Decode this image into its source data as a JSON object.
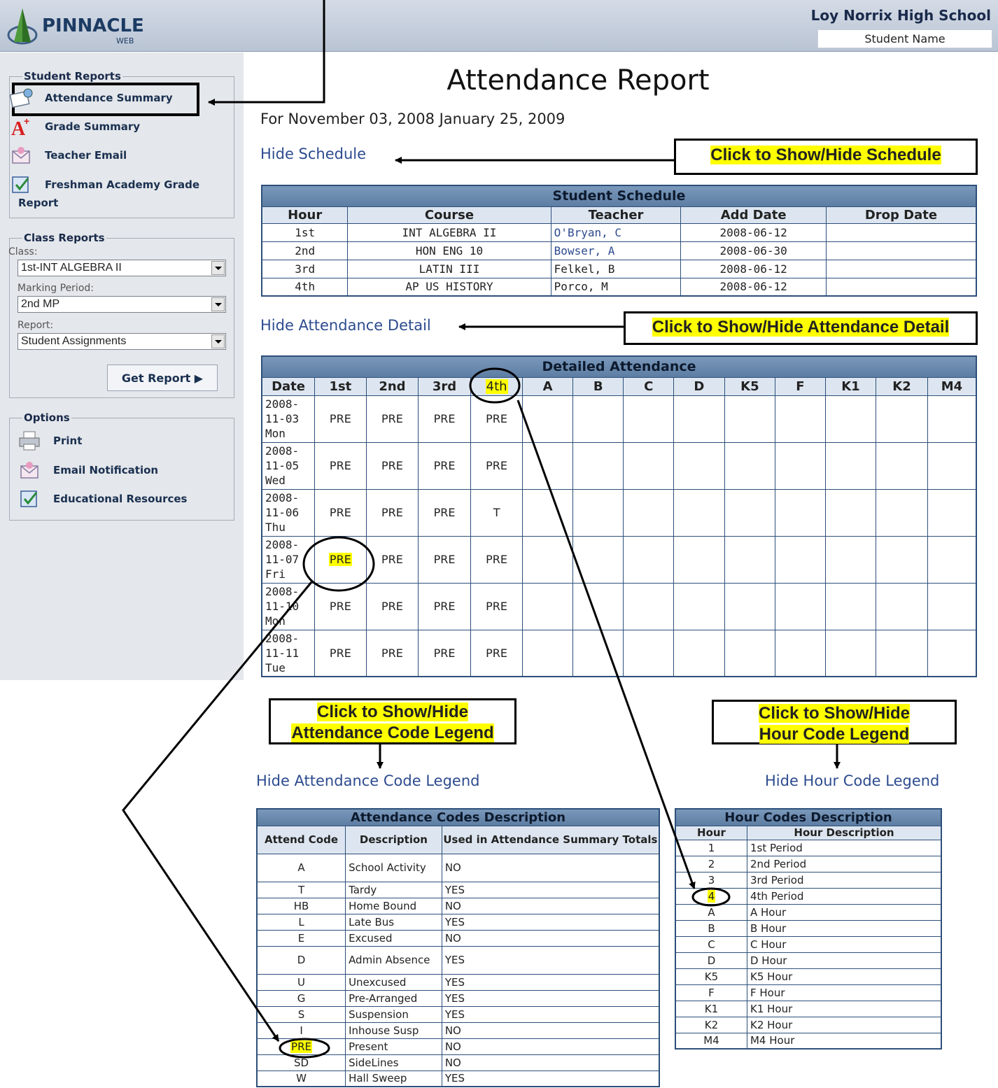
{
  "header": {
    "brand": "PINNACLE",
    "brand_sub": "WEB",
    "school": "Loy Norrix High School",
    "student": "Student Name"
  },
  "sidebar": {
    "student_reports": {
      "legend": "Student Reports",
      "items": [
        {
          "label": "Attendance Summary",
          "icon": "calendar-icon"
        },
        {
          "label": "Grade Summary",
          "icon": "grade-a-plus-icon"
        },
        {
          "label": "Teacher Email",
          "icon": "envelope-icon"
        },
        {
          "label": "Freshman Academy Grade",
          "label2": "Report",
          "icon": "checklist-icon"
        }
      ]
    },
    "class_reports": {
      "legend": "Class Reports",
      "class_label": "Class:",
      "class_value": "1st-INT ALGEBRA II",
      "mp_label": "Marking Period:",
      "mp_value": "2nd MP",
      "report_label": "Report:",
      "report_value": "Student Assignments",
      "button": "Get Report ▶"
    },
    "options": {
      "legend": "Options",
      "items": [
        {
          "label": "Print",
          "icon": "printer-icon"
        },
        {
          "label": "Email Notification",
          "icon": "envelope-icon"
        },
        {
          "label": "Educational Resources",
          "icon": "checklist-icon"
        }
      ]
    }
  },
  "main": {
    "title": "Attendance Report",
    "date_range": "For November 03, 2008 January 25, 2009",
    "hide_schedule": "Hide Schedule",
    "hide_attendance_detail": "Hide Attendance Detail",
    "hide_code_legend": "Hide Attendance Code Legend",
    "hide_hour_legend": "Hide Hour Code Legend"
  },
  "schedule": {
    "caption": "Student Schedule",
    "headers": [
      "Hour",
      "Course",
      "Teacher",
      "Add Date",
      "Drop Date"
    ],
    "rows": [
      {
        "hour": "1st",
        "course": "INT ALGEBRA II",
        "teacher": "O'Bryan, C",
        "teacher_link": true,
        "add": "2008-06-12",
        "drop": ""
      },
      {
        "hour": "2nd",
        "course": "HON ENG 10",
        "teacher": "Bowser, A",
        "teacher_link": true,
        "add": "2008-06-30",
        "drop": ""
      },
      {
        "hour": "3rd",
        "course": "LATIN III",
        "teacher": "Felkel, B",
        "teacher_link": false,
        "add": "2008-06-12",
        "drop": ""
      },
      {
        "hour": "4th",
        "course": "AP US HISTORY",
        "teacher": "Porco, M",
        "teacher_link": false,
        "add": "2008-06-12",
        "drop": ""
      }
    ]
  },
  "attendance": {
    "caption": "Detailed Attendance",
    "headers": [
      "Date",
      "1st",
      "2nd",
      "3rd",
      "4th",
      "A",
      "B",
      "C",
      "D",
      "K5",
      "F",
      "K1",
      "K2",
      "M4"
    ],
    "rows": [
      {
        "date": [
          "2008-",
          "11-03",
          "Mon"
        ],
        "vals": [
          "PRE",
          "PRE",
          "PRE",
          "PRE"
        ]
      },
      {
        "date": [
          "2008-",
          "11-05",
          "Wed"
        ],
        "vals": [
          "PRE",
          "PRE",
          "PRE",
          "PRE"
        ]
      },
      {
        "date": [
          "2008-",
          "11-06",
          "Thu"
        ],
        "vals": [
          "PRE",
          "PRE",
          "PRE",
          "T"
        ]
      },
      {
        "date": [
          "2008-",
          "11-07",
          "Fri"
        ],
        "vals": [
          "PRE",
          "PRE",
          "PRE",
          "PRE"
        ]
      },
      {
        "date": [
          "2008-",
          "11-10",
          "Mon"
        ],
        "vals": [
          "PRE",
          "PRE",
          "PRE",
          "PRE"
        ]
      },
      {
        "date": [
          "2008-",
          "11-11",
          "Tue"
        ],
        "vals": [
          "PRE",
          "PRE",
          "PRE",
          "PRE"
        ]
      }
    ]
  },
  "codes": {
    "caption": "Attendance Codes Description",
    "headers": [
      "Attend Code",
      "Description",
      "Used in Attendance Summary Totals"
    ],
    "rows": [
      [
        "A",
        "School Activity",
        "NO"
      ],
      [
        "T",
        "Tardy",
        "YES"
      ],
      [
        "HB",
        "Home Bound",
        "NO"
      ],
      [
        "L",
        "Late Bus",
        "YES"
      ],
      [
        "E",
        "Excused",
        "NO"
      ],
      [
        "D",
        "Admin Absence",
        "YES"
      ],
      [
        "U",
        "Unexcused",
        "YES"
      ],
      [
        "G",
        "Pre-Arranged",
        "YES"
      ],
      [
        "S",
        "Suspension",
        "YES"
      ],
      [
        "I",
        "Inhouse Susp",
        "NO"
      ],
      [
        "PRE",
        "Present",
        "NO"
      ],
      [
        "SD",
        "SideLines",
        "NO"
      ],
      [
        "W",
        "Hall Sweep",
        "YES"
      ]
    ]
  },
  "hours": {
    "caption": "Hour Codes Description",
    "headers": [
      "Hour",
      "Hour Description"
    ],
    "rows": [
      [
        "1",
        "1st Period"
      ],
      [
        "2",
        "2nd Period"
      ],
      [
        "3",
        "3rd Period"
      ],
      [
        "4",
        "4th Period"
      ],
      [
        "A",
        "A Hour"
      ],
      [
        "B",
        "B Hour"
      ],
      [
        "C",
        "C Hour"
      ],
      [
        "D",
        "D Hour"
      ],
      [
        "K5",
        "K5 Hour"
      ],
      [
        "F",
        "F Hour"
      ],
      [
        "K1",
        "K1 Hour"
      ],
      [
        "K2",
        "K2 Hour"
      ],
      [
        "M4",
        "M4 Hour"
      ]
    ]
  },
  "callouts": {
    "schedule": "Click to Show/Hide Schedule",
    "detail": "Click to Show/Hide Attendance Detail",
    "code_legend_1": "Click to Show/Hide",
    "code_legend_2": "Attendance Code Legend",
    "hour_legend_1": "Click to Show/Hide",
    "hour_legend_2": "Hour Code Legend"
  },
  "colors": {
    "highlight": "#ffff00",
    "table_border": "#2d4f7a",
    "link": "#2d4b8f",
    "sidebar_bg": "#e4e7eb"
  }
}
